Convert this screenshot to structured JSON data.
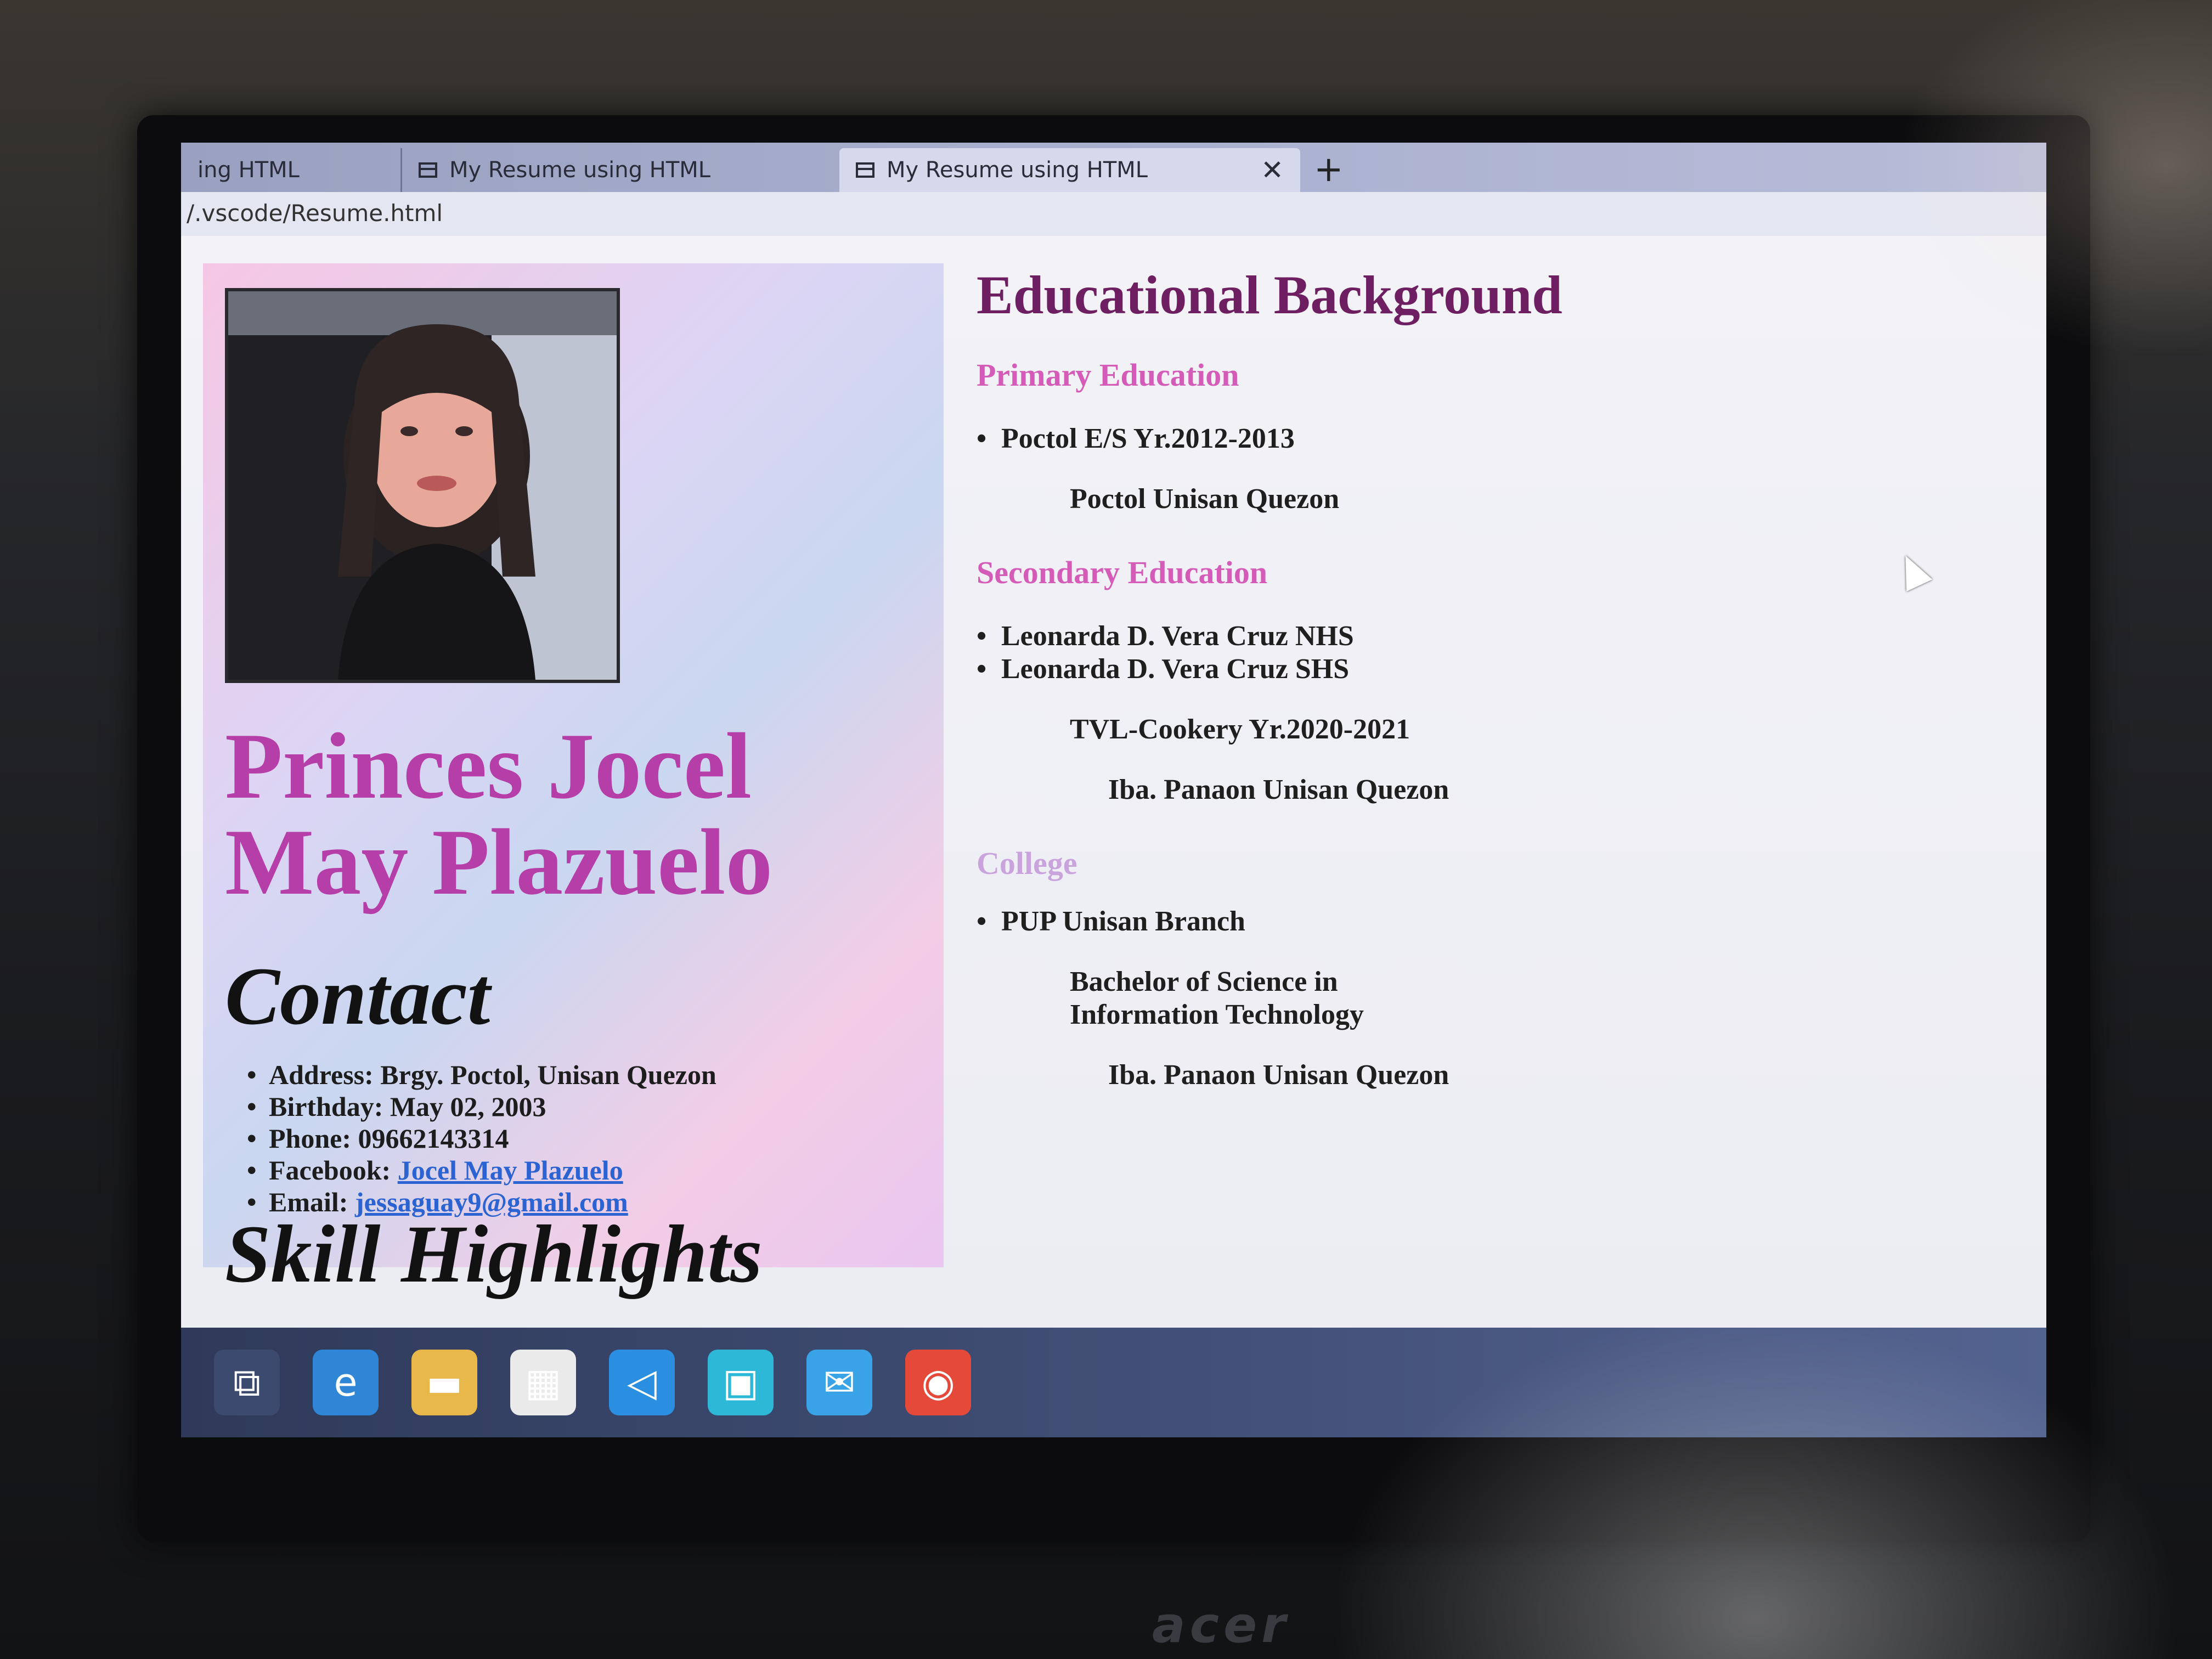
{
  "browser": {
    "tabs": [
      {
        "label": "ing HTML"
      },
      {
        "label": "My Resume using HTML"
      },
      {
        "label": "My Resume using HTML",
        "close": "✕"
      }
    ],
    "new_tab": "+",
    "url": "/.vscode/Resume.html"
  },
  "resume": {
    "name_line1": "Princes Jocel",
    "name_line2": "May Plazuelo",
    "contact_title": "Contact",
    "contact": {
      "address": "Address: Brgy. Poctol, Unisan Quezon",
      "birthday": "Birthday: May 02, 2003",
      "phone": "Phone: 09662143314",
      "facebook_label": "Facebook: ",
      "facebook_link": "Jocel May Plazuelo",
      "email_label": "Email: ",
      "email_link": "jessaguay9@gmail.com"
    },
    "skill_title": "Skill Highlights",
    "edu_title": "Educational Background",
    "primary_label": "Primary Education",
    "primary_school": "Poctol E/S Yr.2012-2013",
    "primary_location": "Poctol Unisan Quezon",
    "secondary_label": "Secondary Education",
    "secondary_school_1": "Leonarda D. Vera Cruz NHS",
    "secondary_school_2": "Leonarda D. Vera Cruz SHS",
    "secondary_strand": "TVL-Cookery Yr.2020-2021",
    "secondary_location": "Iba. Panaon Unisan Quezon",
    "college_label": "College",
    "college_school": "PUP Unisan Branch",
    "college_course_1": "Bachelor of Science in",
    "college_course_2": "Information Technology",
    "college_location": "Iba. Panaon Unisan Quezon"
  },
  "monitor": {
    "brand": "acer"
  },
  "taskbar": {
    "icons": [
      {
        "name": "task-view-icon",
        "glyph": "⧉",
        "color": "#3d4a70"
      },
      {
        "name": "edge-icon",
        "glyph": "e",
        "color": "#2f86d6"
      },
      {
        "name": "file-explorer-icon",
        "glyph": "▬",
        "color": "#e8b84a"
      },
      {
        "name": "store-icon",
        "glyph": "▦",
        "color": "#eaeaea"
      },
      {
        "name": "vscode-icon",
        "glyph": "◁",
        "color": "#2a8fe0"
      },
      {
        "name": "app-icon",
        "glyph": "▣",
        "color": "#2db8d8"
      },
      {
        "name": "mail-icon",
        "glyph": "✉",
        "color": "#3aa3e8"
      },
      {
        "name": "chrome-icon",
        "glyph": "◉",
        "color": "#e5493a"
      }
    ]
  }
}
